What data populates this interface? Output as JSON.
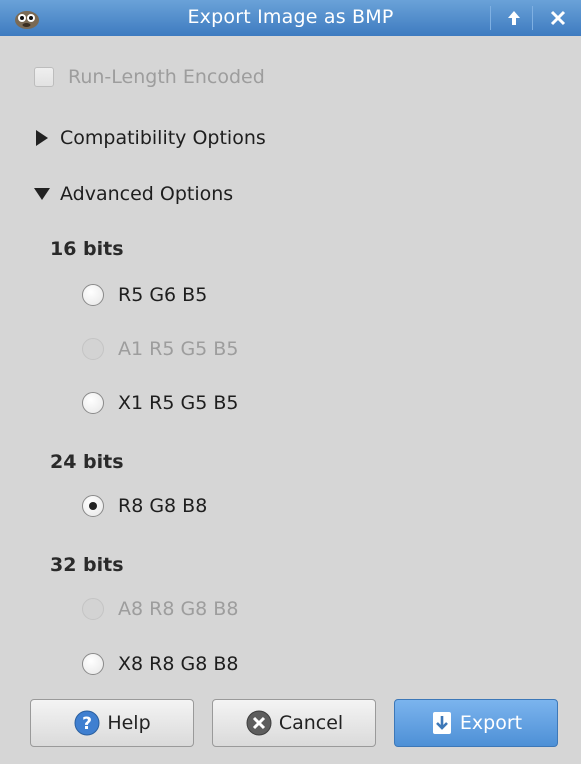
{
  "window": {
    "title": "Export Image as BMP",
    "controls": [
      "up-arrow-icon",
      "close-icon"
    ]
  },
  "run_length": {
    "label": "Run-Length Encoded",
    "checked": false,
    "enabled": false
  },
  "compatibility": {
    "label": "Compatibility Options",
    "expanded": false
  },
  "advanced": {
    "label": "Advanced Options",
    "expanded": true,
    "groups": [
      {
        "label": "16 bits",
        "options": [
          {
            "label": "R5 G6 B5",
            "enabled": true,
            "selected": false
          },
          {
            "label": "A1 R5 G5 B5",
            "enabled": false,
            "selected": false
          },
          {
            "label": "X1 R5 G5 B5",
            "enabled": true,
            "selected": false
          }
        ]
      },
      {
        "label": "24 bits",
        "options": [
          {
            "label": "R8 G8 B8",
            "enabled": true,
            "selected": true
          }
        ]
      },
      {
        "label": "32 bits",
        "options": [
          {
            "label": "A8 R8 G8 B8",
            "enabled": false,
            "selected": false
          },
          {
            "label": "X8 R8 G8 B8",
            "enabled": true,
            "selected": false
          }
        ]
      }
    ]
  },
  "buttons": {
    "help": {
      "label": "Help",
      "icon": "help-icon"
    },
    "cancel": {
      "label": "Cancel",
      "icon": "cancel-icon"
    },
    "export": {
      "label": "Export",
      "icon": "export-icon"
    }
  }
}
